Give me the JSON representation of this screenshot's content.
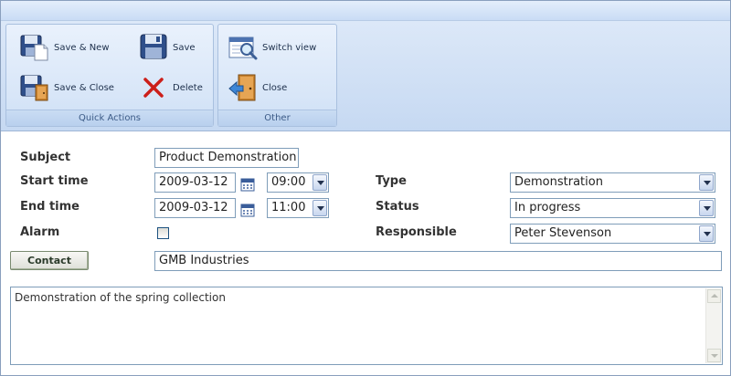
{
  "ribbon": {
    "groups": [
      {
        "caption": "Quick Actions",
        "buttons": [
          {
            "label": "Save & New",
            "icon": "save-new-icon"
          },
          {
            "label": "Save",
            "icon": "save-icon"
          },
          {
            "label": "Save & Close",
            "icon": "save-close-icon"
          },
          {
            "label": "Delete",
            "icon": "delete-icon"
          }
        ]
      },
      {
        "caption": "Other",
        "buttons": [
          {
            "label": "Switch view",
            "icon": "switch-view-icon"
          },
          {
            "label": "Close",
            "icon": "close-door-icon"
          }
        ]
      }
    ]
  },
  "form": {
    "subject": {
      "label": "Subject",
      "value": "Product Demonstration"
    },
    "start": {
      "label": "Start time",
      "date": "2009-03-12",
      "time": "09:00"
    },
    "end": {
      "label": "End time",
      "date": "2009-03-12",
      "time": "11:00"
    },
    "alarm": {
      "label": "Alarm",
      "checked": false
    },
    "type": {
      "label": "Type",
      "value": "Demonstration"
    },
    "status": {
      "label": "Status",
      "value": "In progress"
    },
    "responsible": {
      "label": "Responsible",
      "value": "Peter Stevenson"
    },
    "contact": {
      "button_label": "Contact",
      "value": "GMB Industries"
    },
    "notes": "Demonstration of the spring collection"
  },
  "colors": {
    "ribbon_bg": "#c6d9f2",
    "field_border": "#7f9db9",
    "delete_red": "#cc1f1a"
  }
}
